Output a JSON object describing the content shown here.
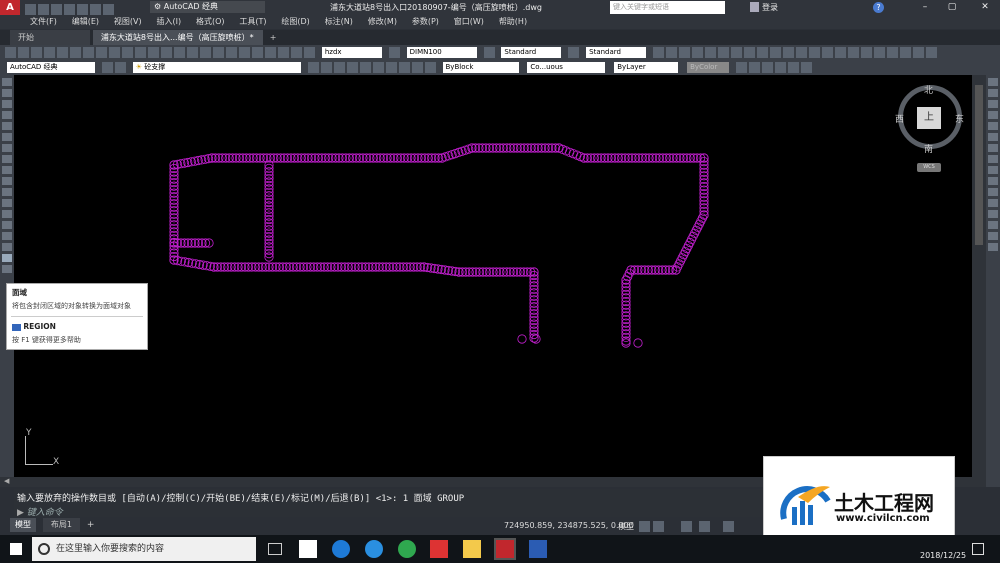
{
  "window": {
    "title": "浦东大道站8号出入口20180907-编号（高压旋喷桩）.dwg",
    "workspace": "AutoCAD 经典",
    "search_placeholder": "键入关键字或短语",
    "login": "登录"
  },
  "menu": [
    "文件(F)",
    "编辑(E)",
    "视图(V)",
    "插入(I)",
    "格式(O)",
    "工具(T)",
    "绘图(D)",
    "标注(N)",
    "修改(M)",
    "参数(P)",
    "窗口(W)",
    "帮助(H)"
  ],
  "tabs": {
    "start": "开始",
    "doc": "浦东大道站8号出入...编号（高压旋喷桩）*"
  },
  "toolbar": {
    "text_style": "hzdx",
    "dim_style": "DIMN100",
    "table_style": "Standard",
    "mleader_style": "Standard",
    "workspace2": "AutoCAD 经典",
    "layer": "砼支撑",
    "color": "ByBlock",
    "linetype": "Co...uous",
    "lineweight": "ByLayer",
    "plotstyle": "ByColor"
  },
  "viewcube": {
    "north": "北",
    "south": "南",
    "east": "东",
    "west": "西",
    "top": "上",
    "wcs": "WCS"
  },
  "ucs": {
    "y": "Y",
    "x": "X"
  },
  "tooltip": {
    "title": "面域",
    "desc": "将包含封闭区域的对象转换为面域对象",
    "command": "REGION",
    "help": "按 F1 键获得更多帮助"
  },
  "command": {
    "history": "输入要放弃的操作数目或 [自动(A)/控制(C)/开始(BE)/结束(E)/标记(M)/后退(B)] <1>: 1 面域 GROUP",
    "placeholder": "键入命令"
  },
  "layout_tabs": [
    "模型",
    "布局1"
  ],
  "status": {
    "coords": "724950.859, 234875.525, 0.000",
    "mode": "模型"
  },
  "taskbar": {
    "search": "在这里输入你要搜索的内容",
    "date": "2018/12/25"
  },
  "watermark": {
    "name": "土木工程网",
    "url": "www.civilcn.com"
  }
}
